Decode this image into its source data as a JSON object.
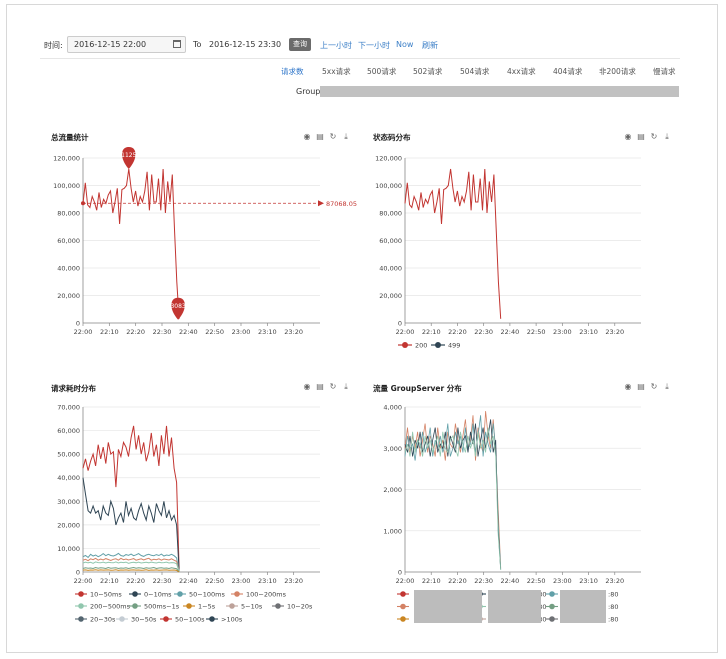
{
  "toolbar": {
    "time_label": "时间:",
    "start_value": "2016-12-15 22:00",
    "to_label": "To",
    "end_value": "2016-12-15 23:30",
    "query_label": "查询",
    "prev_hour": "上一小时",
    "next_hour": "下一小时",
    "now": "Now",
    "refresh": "刷新"
  },
  "tabs": [
    "请求数",
    "5xx请求",
    "500请求",
    "502请求",
    "504请求",
    "4xx请求",
    "404请求",
    "非200请求",
    "慢请求"
  ],
  "active_tab": "请求数",
  "group_label": "Group",
  "icons": [
    "eye-icon",
    "document-icon",
    "refresh-icon",
    "download-icon"
  ],
  "colors": {
    "red": "#c23531",
    "navy": "#2f4554",
    "teal": "#61a0a8",
    "orange": "#d48265",
    "grid": "#e6e6e6"
  },
  "time_ticks": [
    "22:00",
    "22:10",
    "22:20",
    "22:30",
    "22:40",
    "22:50",
    "23:00",
    "23:10",
    "23:20"
  ],
  "chart_data": [
    {
      "type": "line",
      "title": "总流量统计",
      "ylim": [
        0,
        120000
      ],
      "yticks": [
        "0",
        "20,000",
        "40,000",
        "60,000",
        "80,000",
        "100,000",
        "120,000"
      ],
      "x": [
        "22:00",
        "22:10",
        "22:20",
        "22:30",
        "22:40",
        "22:50",
        "23:00",
        "23:10",
        "23:20"
      ],
      "series": [
        {
          "values": [
            87000,
            102000,
            86000,
            84000,
            92000,
            88000,
            82000,
            95000,
            84000,
            90000,
            87000,
            93000,
            96000,
            80000,
            88000,
            98000,
            72000,
            97000,
            98000,
            100000,
            112000,
            98000,
            88000,
            96000,
            85000,
            92000,
            88000,
            96000,
            110000,
            82000,
            108000,
            88000,
            88000,
            105000,
            82000,
            112000,
            80000,
            103000,
            88000,
            108000,
            68000,
            30000,
            3083
          ]
        }
      ],
      "annotations": {
        "max_label": "111251",
        "min_label": "3083",
        "mean_label": "87068.05"
      }
    },
    {
      "type": "line",
      "title": "状态码分布",
      "ylim": [
        0,
        120000
      ],
      "yticks": [
        "0",
        "20,000",
        "40,000",
        "60,000",
        "80,000",
        "100,000",
        "120,000"
      ],
      "x": [
        "22:00",
        "22:10",
        "22:20",
        "22:30",
        "22:40",
        "22:50",
        "23:00",
        "23:10",
        "23:20"
      ],
      "series": [
        {
          "name": "200",
          "values": [
            87000,
            102000,
            86000,
            84000,
            92000,
            88000,
            82000,
            95000,
            84000,
            90000,
            87000,
            93000,
            96000,
            80000,
            88000,
            98000,
            72000,
            97000,
            98000,
            100000,
            112000,
            98000,
            88000,
            96000,
            85000,
            92000,
            88000,
            96000,
            110000,
            82000,
            108000,
            88000,
            88000,
            105000,
            82000,
            112000,
            80000,
            103000,
            88000,
            108000,
            68000,
            30000,
            3083
          ]
        },
        {
          "name": "499",
          "values": []
        }
      ]
    },
    {
      "type": "line",
      "title": "请求耗时分布",
      "ylim": [
        0,
        70000
      ],
      "yticks": [
        "0",
        "10,000",
        "20,000",
        "30,000",
        "40,000",
        "50,000",
        "60,000",
        "70,000"
      ],
      "x": [
        "22:00",
        "22:10",
        "22:20",
        "22:30",
        "22:40",
        "22:50",
        "23:00",
        "23:10",
        "23:20"
      ],
      "series": [
        {
          "name": "10~50ms",
          "values": [
            44000,
            48000,
            43000,
            47000,
            50000,
            45000,
            54000,
            48000,
            53000,
            46000,
            55000,
            50000,
            51000,
            36000,
            52000,
            49000,
            55000,
            53000,
            49000,
            57000,
            62000,
            52000,
            58000,
            50000,
            55000,
            47000,
            51000,
            59000,
            49000,
            54000,
            45000,
            58000,
            50000,
            62000,
            49000,
            57000,
            44000,
            38000,
            1500
          ]
        },
        {
          "name": "0~10ms",
          "values": [
            40000,
            33000,
            26000,
            25000,
            28000,
            25000,
            26000,
            22000,
            28000,
            25000,
            24000,
            30000,
            27000,
            20000,
            23000,
            25000,
            21000,
            30000,
            24000,
            27000,
            23000,
            22000,
            26000,
            29000,
            25000,
            22000,
            28000,
            25000,
            21000,
            29000,
            26000,
            24000,
            30000,
            23000,
            26000,
            22000,
            24000,
            20000,
            500
          ]
        },
        {
          "name": "50~100ms",
          "values": [
            6500,
            7000,
            6200,
            7500,
            6800,
            7200,
            6500,
            7000,
            7800,
            6900,
            7500,
            7000,
            6800,
            7200,
            7900,
            7000,
            6700,
            7400,
            7100,
            7600,
            6900,
            7300,
            7800,
            7000,
            6600,
            7200,
            7500,
            7100,
            6900,
            7400,
            7000,
            7600,
            6800,
            7200,
            7000,
            7500,
            6900,
            6000,
            300
          ]
        },
        {
          "name": "100~200ms",
          "values": [
            5000,
            5400,
            4800,
            5600,
            5200,
            5800,
            5000,
            5500,
            5100,
            5700,
            5300,
            4900,
            5400,
            5600,
            5000,
            5800,
            5200,
            5500,
            5100,
            5400,
            5700,
            5000,
            5300,
            5600,
            5100,
            5500,
            5800,
            5000,
            5400,
            5200,
            5600,
            5000,
            5500,
            5300,
            5100,
            5600,
            5000,
            4500,
            200
          ]
        },
        {
          "name": "200~500ms",
          "values": [
            3800,
            4200,
            3900,
            4100,
            3700,
            4300,
            4000,
            3900,
            4200,
            3800,
            4100,
            4000,
            3900,
            4300,
            3800,
            4100,
            4000,
            4200,
            3700,
            4000,
            4100,
            3900,
            4200,
            3800,
            4000,
            4100,
            3900,
            4200,
            4000,
            3800,
            4100,
            3900,
            4000,
            4200,
            3800,
            4000,
            3900,
            3500,
            100
          ]
        },
        {
          "name": "500ms~1s",
          "values": [
            1500,
            1800,
            1600,
            1700,
            1500,
            1900,
            1600,
            1800,
            1700,
            1500,
            1900,
            1600,
            1700,
            1800,
            1500,
            1700,
            1600,
            1800,
            1500,
            1700,
            1900,
            1600,
            1800,
            1700,
            1500,
            1800,
            1600,
            1700,
            1900,
            1500,
            1700,
            1800,
            1600,
            1700,
            1500,
            1800,
            1600,
            1400,
            50
          ]
        },
        {
          "name": "1~5s",
          "values": [
            800,
            900,
            700,
            850,
            800,
            950,
            750,
            900,
            800,
            850,
            900,
            750,
            800,
            950,
            700,
            850,
            800,
            900,
            750,
            850,
            900,
            800,
            850,
            750,
            800,
            950,
            700,
            850,
            800,
            900,
            750,
            800,
            850,
            900,
            750,
            800,
            850,
            700,
            20
          ]
        },
        {
          "name": "5~10s",
          "values": []
        },
        {
          "name": "10~20s",
          "values": []
        },
        {
          "name": "20~30s",
          "values": []
        },
        {
          "name": "30~50s",
          "values": []
        },
        {
          "name": "50~100s",
          "values": []
        },
        {
          "name": ">100s",
          "values": []
        }
      ]
    },
    {
      "type": "line",
      "title": "流量 GroupServer 分布",
      "ylim": [
        0,
        4000
      ],
      "yticks": [
        "0",
        "1,000",
        "2,000",
        "3,000",
        "4,000"
      ],
      "x": [
        "22:00",
        "22:10",
        "22:20",
        "22:30",
        "22:40",
        "22:50",
        "23:00",
        "23:10",
        "23:20"
      ],
      "series": [
        {
          "values": [
            3000,
            3500,
            2900,
            3300,
            3000,
            3400,
            2800,
            3200,
            3600,
            2900,
            3300,
            3100,
            2800,
            3500,
            3000,
            3200,
            2700,
            3400,
            3100,
            3000,
            3600,
            3200,
            2900,
            3300,
            3700,
            3000,
            3200,
            3800,
            2700,
            3500,
            3100,
            2900,
            3900,
            3300,
            3000,
            3700,
            2900,
            1500,
            100
          ]
        },
        {
          "values": [
            2800,
            3300,
            3000,
            3100,
            2700,
            3200,
            3000,
            3400,
            2900,
            3100,
            3500,
            2800,
            3200,
            3000,
            3300,
            2900,
            3100,
            3600,
            2800,
            3000,
            3400,
            3100,
            3300,
            2900,
            3500,
            3000,
            3100,
            3600,
            2900,
            3300,
            3800,
            2800,
            3400,
            3100,
            2900,
            3600,
            3000,
            1200,
            80
          ]
        },
        {
          "values": [
            3100,
            2900,
            3300,
            2800,
            3200,
            3000,
            3400,
            2900,
            3100,
            3300,
            2800,
            3200,
            3500,
            2900,
            3100,
            3000,
            3400,
            2800,
            3300,
            3100,
            2900,
            3500,
            3000,
            3200,
            3300,
            2900,
            3400,
            3100,
            3600,
            2800,
            3200,
            3500,
            3000,
            3300,
            3700,
            2900,
            3200,
            1000,
            60
          ]
        },
        {
          "values": [
            2900,
            3100,
            2800,
            3400,
            2900,
            3200,
            3100,
            2800,
            3300,
            3000,
            3200,
            2900,
            3100,
            3300,
            2800,
            3400,
            3000,
            2900,
            3200,
            3300,
            3000,
            2800,
            3400,
            3100,
            2900,
            3300,
            3000,
            3200,
            2800,
            3400,
            3000,
            3200,
            2900,
            3500,
            3100,
            3300,
            2800,
            900,
            50
          ]
        }
      ],
      "legend_suffix": [
        ":80",
        ":80",
        ":80",
        ":80",
        ":80",
        ":80",
        ":80",
        ":80",
        ":80"
      ]
    }
  ]
}
